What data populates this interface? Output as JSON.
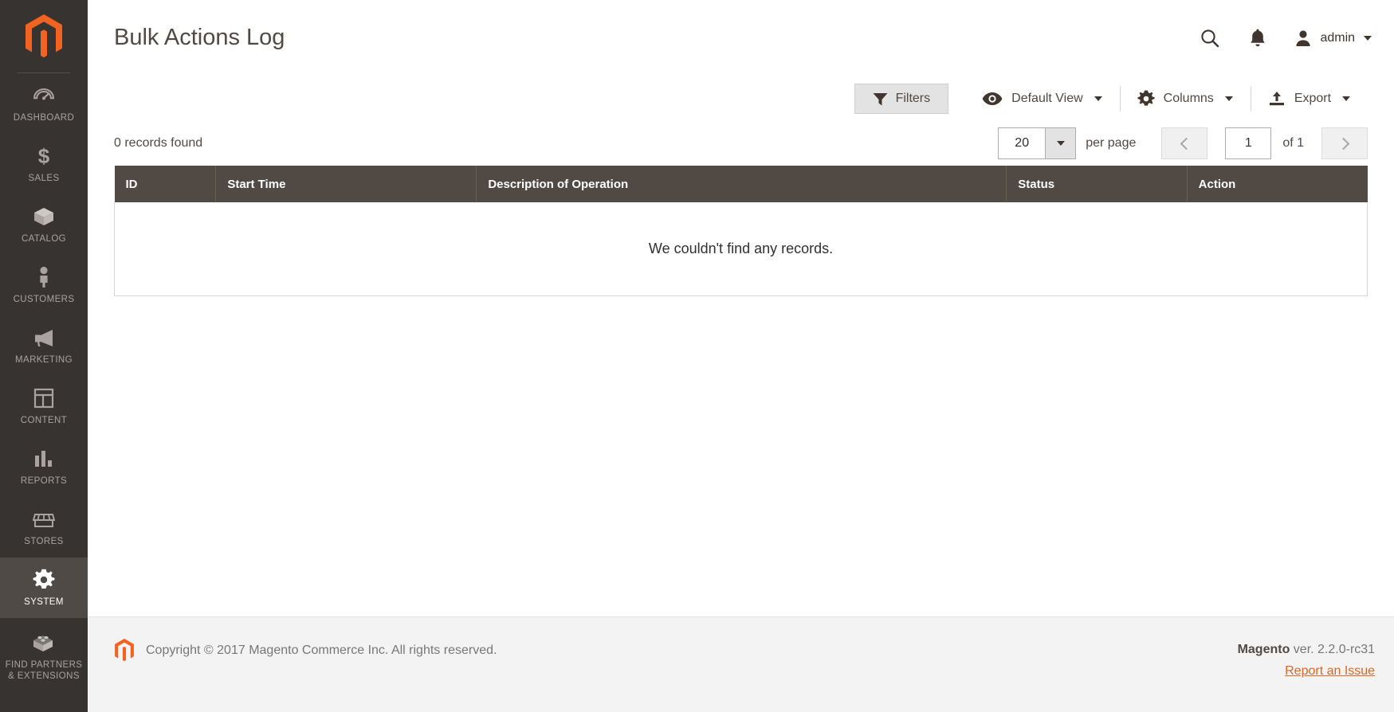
{
  "sidebar": {
    "logo": "magento-logo",
    "items": [
      {
        "label": "Dashboard",
        "icon": "dashboard-icon",
        "active": false
      },
      {
        "label": "Sales",
        "icon": "sales-icon",
        "active": false
      },
      {
        "label": "Catalog",
        "icon": "catalog-icon",
        "active": false
      },
      {
        "label": "Customers",
        "icon": "customers-icon",
        "active": false
      },
      {
        "label": "Marketing",
        "icon": "marketing-icon",
        "active": false
      },
      {
        "label": "Content",
        "icon": "content-icon",
        "active": false
      },
      {
        "label": "Reports",
        "icon": "reports-icon",
        "active": false
      },
      {
        "label": "Stores",
        "icon": "stores-icon",
        "active": false
      },
      {
        "label": "System",
        "icon": "system-gear-icon",
        "active": true
      },
      {
        "label": "Find Partners\n& Extensions",
        "icon": "extensions-icon",
        "active": false
      }
    ]
  },
  "header": {
    "title": "Bulk Actions Log",
    "search_icon": "search-icon",
    "notifications_icon": "bell-icon",
    "user_icon": "user-avatar-icon",
    "user_name": "admin",
    "user_caret": "chevron-down-icon"
  },
  "toolbar": {
    "filters_label": "Filters",
    "filters_icon": "funnel-icon",
    "view_label": "Default View",
    "view_icon": "eye-icon",
    "columns_label": "Columns",
    "columns_icon": "gear-icon",
    "export_label": "Export",
    "export_icon": "upload-icon"
  },
  "grid": {
    "records_found": "0 records found",
    "per_page_value": "20",
    "per_page_label": "per page",
    "page_value": "1",
    "page_total": "of 1",
    "prev_icon": "chevron-left-icon",
    "next_icon": "chevron-right-icon",
    "columns": [
      "ID",
      "Start Time",
      "Description of Operation",
      "Status",
      "Action"
    ],
    "empty_message": "We couldn't find any records."
  },
  "footer": {
    "logo": "magento-logo-small",
    "copyright": "Copyright © 2017 Magento Commerce Inc. All rights reserved.",
    "version_brand": "Magento",
    "version_text": " ver. 2.2.0-rc31",
    "report_link": "Report an Issue"
  },
  "colors": {
    "sidebar_bg": "#373330",
    "sidebar_active_bg": "#4f4a46",
    "accent_orange": "#e06624",
    "table_header_bg": "#514943",
    "text_primary": "#514943",
    "footer_bg": "#f3f3f3"
  }
}
